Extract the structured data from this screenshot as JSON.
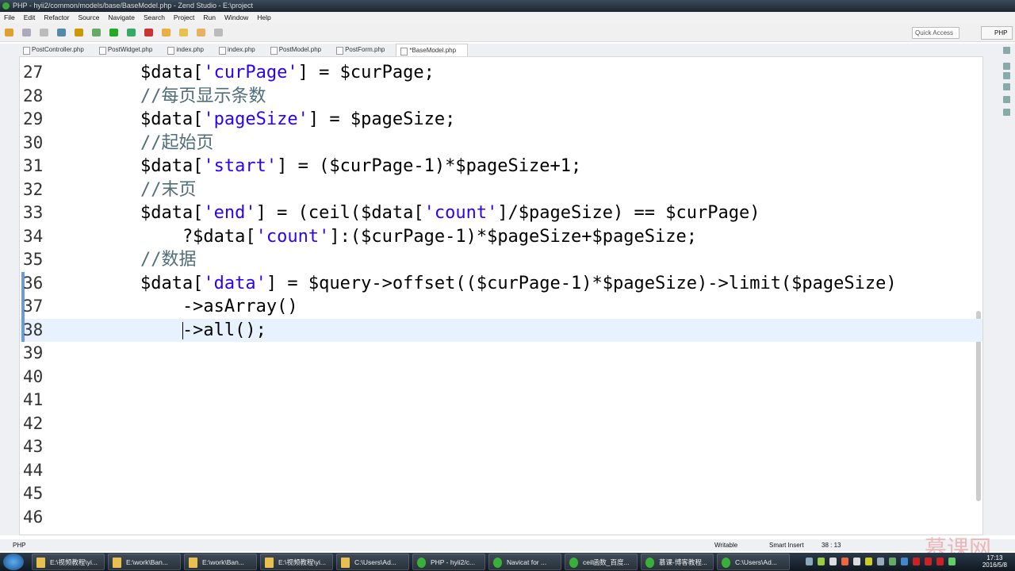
{
  "window": {
    "title": "PHP - hyii2/common/models/base/BaseModel.php - Zend Studio - E:\\project"
  },
  "menu": [
    "File",
    "Edit",
    "Refactor",
    "Source",
    "Navigate",
    "Search",
    "Project",
    "Run",
    "Window",
    "Help"
  ],
  "toolbar": {
    "quick_access": "Quick Access",
    "perspective": "PHP"
  },
  "tabs": [
    {
      "label": "PostController.php"
    },
    {
      "label": "PostWidget.php"
    },
    {
      "label": "index.php"
    },
    {
      "label": "index.php"
    },
    {
      "label": "PostModel.php"
    },
    {
      "label": "PostForm.php"
    },
    {
      "label": "*BaseModel.php",
      "active": true
    }
  ],
  "editor": {
    "current_line": 38,
    "lines": [
      {
        "n": "27",
        "seg": [
          [
            "",
            "        $data["
          ],
          [
            "s",
            "'curPage'"
          ],
          [
            "",
            "] = $curPage;"
          ]
        ]
      },
      {
        "n": "28",
        "seg": [
          [
            "c",
            "        //每页显示条数"
          ]
        ]
      },
      {
        "n": "29",
        "seg": [
          [
            "",
            "        $data["
          ],
          [
            "s",
            "'pageSize'"
          ],
          [
            "",
            "] = $pageSize;"
          ]
        ]
      },
      {
        "n": "30",
        "seg": [
          [
            "c",
            "        //起始页"
          ]
        ]
      },
      {
        "n": "31",
        "seg": [
          [
            "",
            "        $data["
          ],
          [
            "s",
            "'start'"
          ],
          [
            "",
            "] = ($curPage-1)*$pageSize+1;"
          ]
        ]
      },
      {
        "n": "32",
        "seg": [
          [
            "c",
            "        //末页"
          ]
        ]
      },
      {
        "n": "33",
        "seg": [
          [
            "",
            "        $data["
          ],
          [
            "s",
            "'end'"
          ],
          [
            "",
            "] = (ceil($data["
          ],
          [
            "s",
            "'count'"
          ],
          [
            "",
            "]/$pageSize) == $curPage)"
          ]
        ]
      },
      {
        "n": "34",
        "seg": [
          [
            "",
            "            ?$data["
          ],
          [
            "s",
            "'count'"
          ],
          [
            "",
            "]:($curPage-1)*$pageSize+$pageSize;"
          ]
        ]
      },
      {
        "n": "35",
        "seg": [
          [
            "c",
            "        //数据"
          ]
        ]
      },
      {
        "n": "36",
        "seg": [
          [
            "",
            "        $data["
          ],
          [
            "s",
            "'data'"
          ],
          [
            "",
            "] = $query->offset(($curPage-1)*$pageSize)->limit($pageSize)"
          ]
        ]
      },
      {
        "n": "37",
        "seg": [
          [
            "",
            "            ->asArray()"
          ]
        ]
      },
      {
        "n": "38",
        "seg": [
          [
            "",
            "            ->all();"
          ]
        ]
      },
      {
        "n": "39",
        "seg": []
      },
      {
        "n": "40",
        "seg": []
      },
      {
        "n": "41",
        "seg": []
      },
      {
        "n": "42",
        "seg": []
      },
      {
        "n": "43",
        "seg": []
      },
      {
        "n": "44",
        "seg": []
      },
      {
        "n": "45",
        "seg": []
      },
      {
        "n": "46",
        "seg": []
      }
    ]
  },
  "status": {
    "language": "PHP",
    "mode": "Writable",
    "insert": "Smart Insert",
    "position": "38 : 13"
  },
  "taskbar": {
    "items": [
      "E:\\视频教程\\yi...",
      "E:\\work\\Ban...",
      "E:\\work\\Ban...",
      "E:\\视频教程\\yi...",
      "C:\\Users\\Ad...",
      "PHP - hyii2/c...",
      "Navicat for ...",
      "ceil函数_百度...",
      "慕课-博客教程...",
      "C:\\Users\\Ad..."
    ],
    "time": "17:13",
    "date": "2016/5/8"
  },
  "watermark": "慕课网"
}
